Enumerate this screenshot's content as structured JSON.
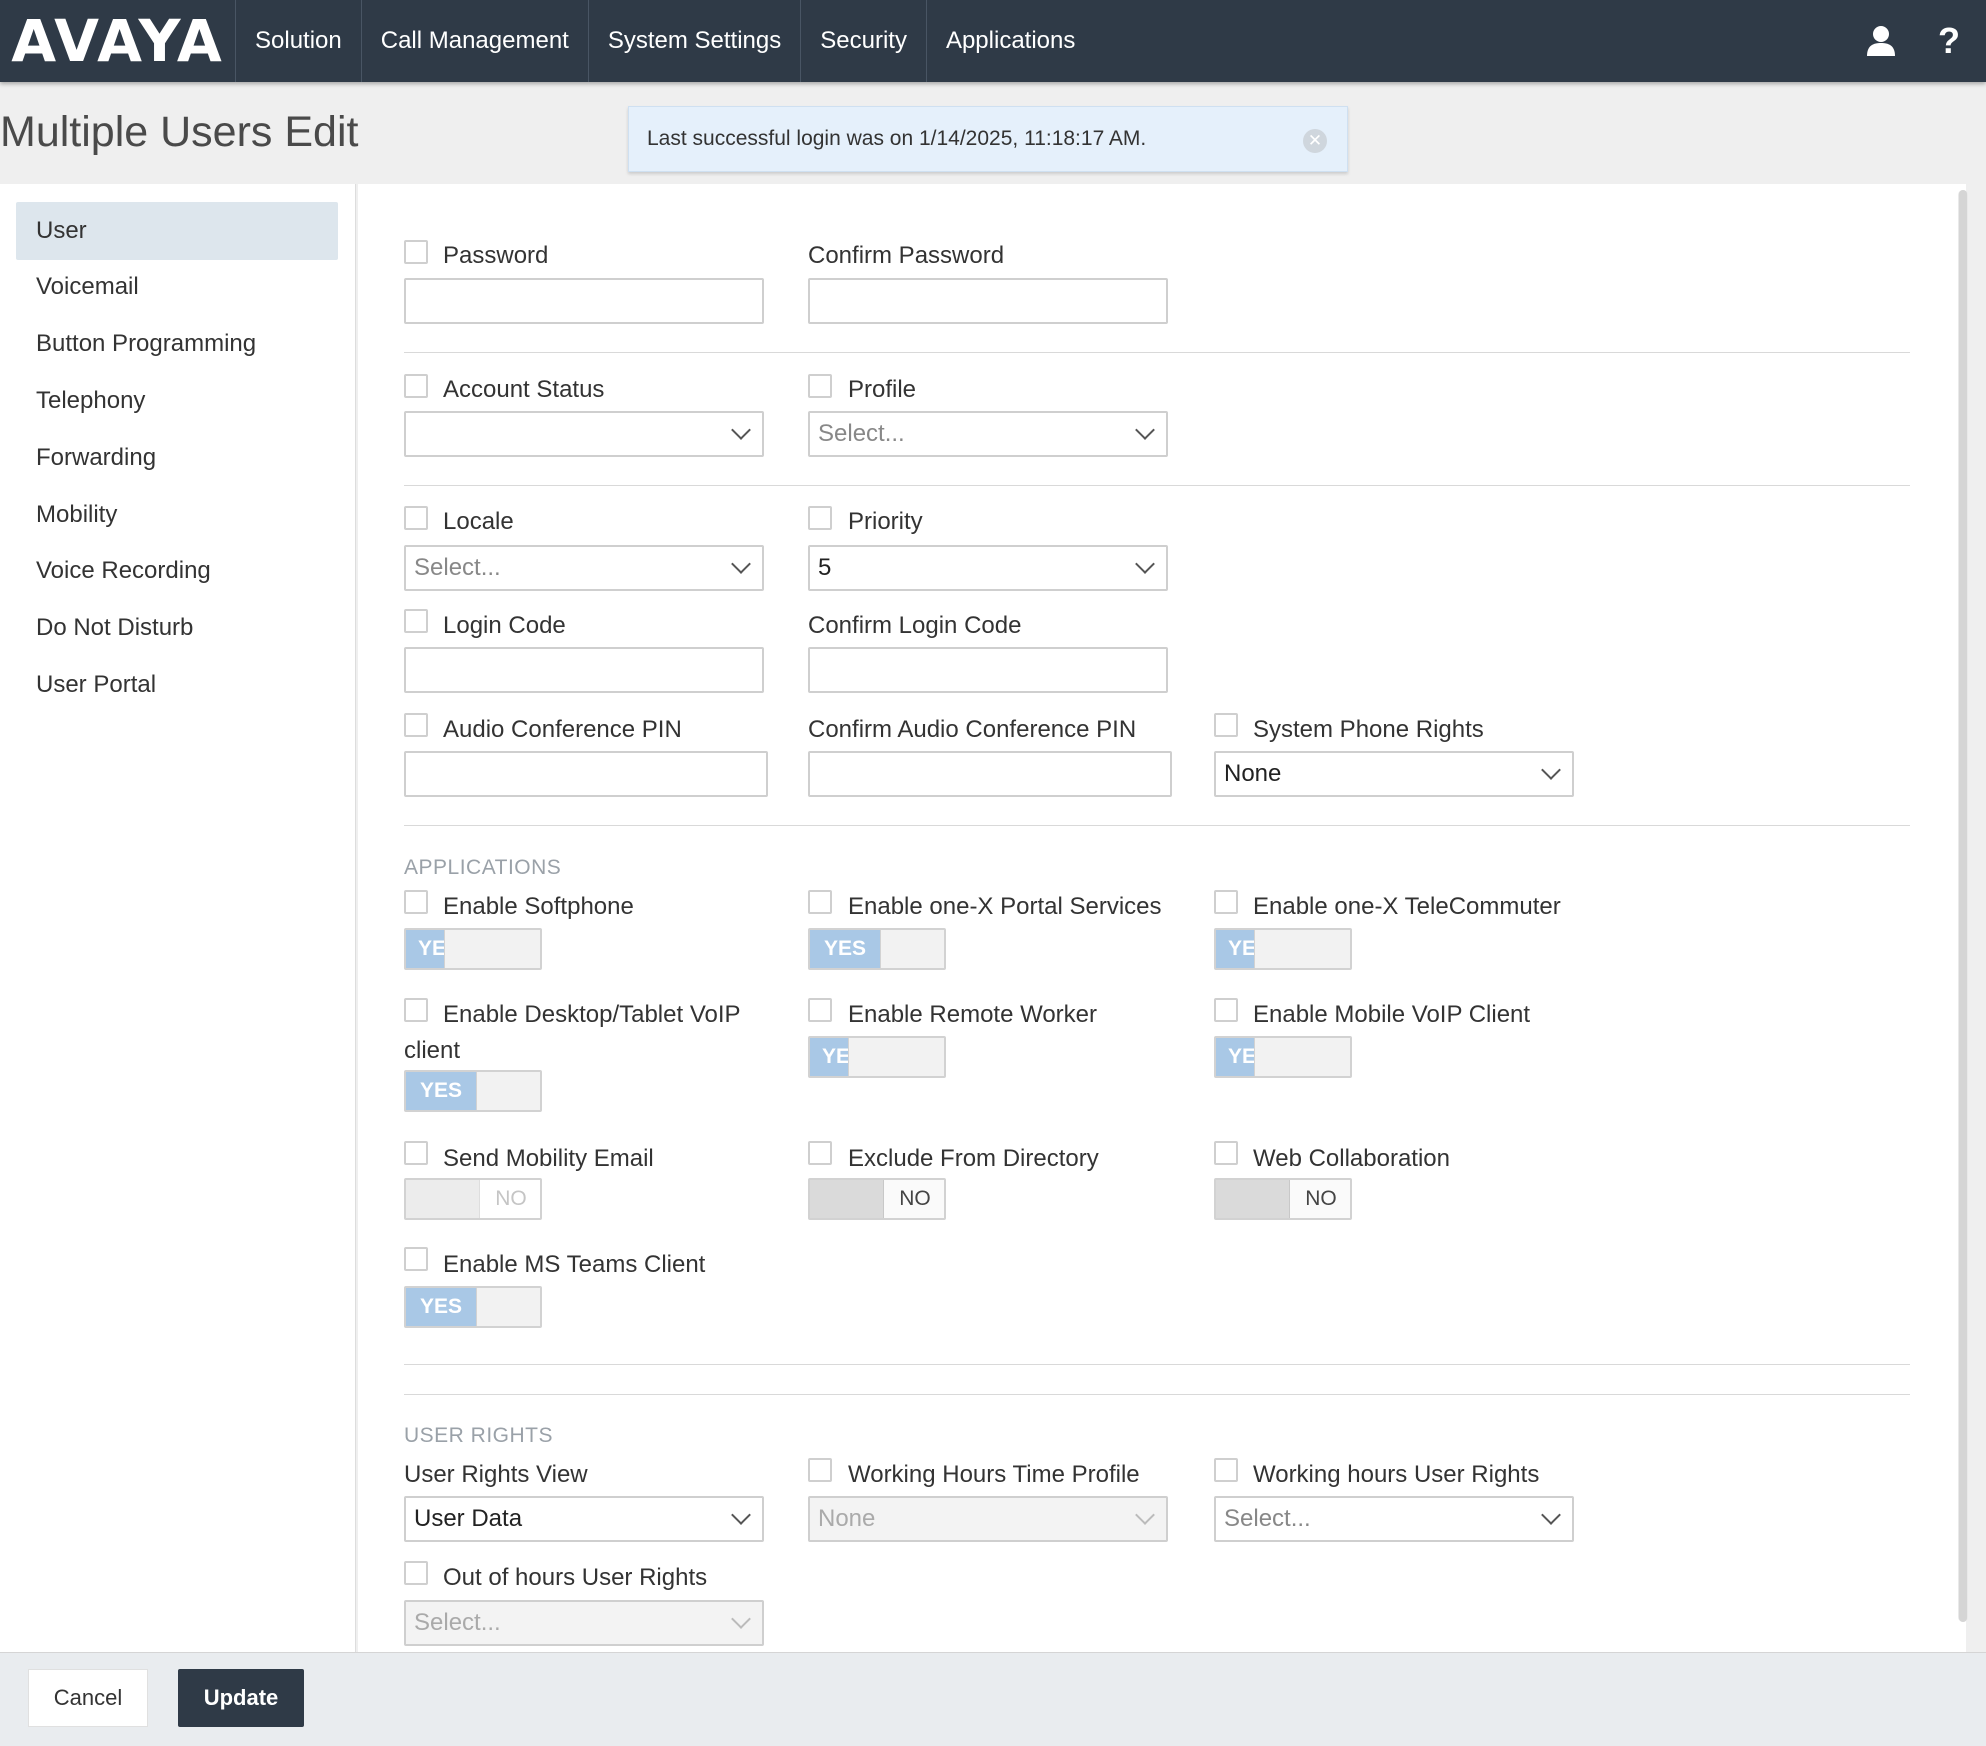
{
  "brand": "AVAYA",
  "nav": {
    "items": [
      "Solution",
      "Call Management",
      "System Settings",
      "Security",
      "Applications"
    ]
  },
  "header_icons": {
    "user": "user-icon",
    "help": "?"
  },
  "page_title": "Multiple Users Edit",
  "toast": {
    "message": "Last successful login was on 1/14/2025, 11:18:17 AM."
  },
  "sidebar": {
    "items": [
      {
        "label": "User",
        "active": true
      },
      {
        "label": "Voicemail"
      },
      {
        "label": "Button Programming"
      },
      {
        "label": "Telephony"
      },
      {
        "label": "Forwarding"
      },
      {
        "label": "Mobility"
      },
      {
        "label": "Voice Recording"
      },
      {
        "label": "Do Not Disturb"
      },
      {
        "label": "User Portal"
      }
    ]
  },
  "form": {
    "password": "Password",
    "confirm_password": "Confirm Password",
    "account_status": "Account Status",
    "account_status_value": "",
    "profile": "Profile",
    "profile_value": "Select...",
    "locale": "Locale",
    "locale_value": "Select...",
    "priority": "Priority",
    "priority_value": "5",
    "login_code": "Login Code",
    "confirm_login_code": "Confirm Login Code",
    "audio_pin": "Audio Conference PIN",
    "confirm_audio_pin": "Confirm Audio Conference PIN",
    "system_phone_rights": "System Phone Rights",
    "system_phone_rights_value": "None"
  },
  "applications": {
    "header": "APPLICATIONS",
    "enable_softphone": "Enable Softphone",
    "enable_portal": "Enable one-X Portal Services",
    "enable_telecommuter": "Enable one-X TeleCommuter",
    "enable_desktop_line1": "Enable Desktop/Tablet VoIP",
    "enable_desktop_line2": "client",
    "enable_remote_worker": "Enable Remote Worker",
    "enable_mobile_voip": "Enable Mobile VoIP Client",
    "send_mobility_email": "Send Mobility Email",
    "exclude_directory": "Exclude From Directory",
    "web_collaboration": "Web Collaboration",
    "enable_ms_teams": "Enable MS Teams Client",
    "yes": "YES",
    "yes_partial": "YE",
    "no": "NO"
  },
  "user_rights": {
    "header": "USER RIGHTS",
    "view_label": "User Rights View",
    "view_value": "User Data",
    "working_hours_time_profile": "Working Hours Time Profile",
    "working_hours_time_profile_value": "None",
    "working_hours_user_rights": "Working hours User Rights",
    "working_hours_user_rights_value": "Select...",
    "out_of_hours_user_rights": "Out of hours User Rights",
    "out_of_hours_user_rights_value": "Select..."
  },
  "buttons": {
    "cancel": "Cancel",
    "update": "Update"
  }
}
